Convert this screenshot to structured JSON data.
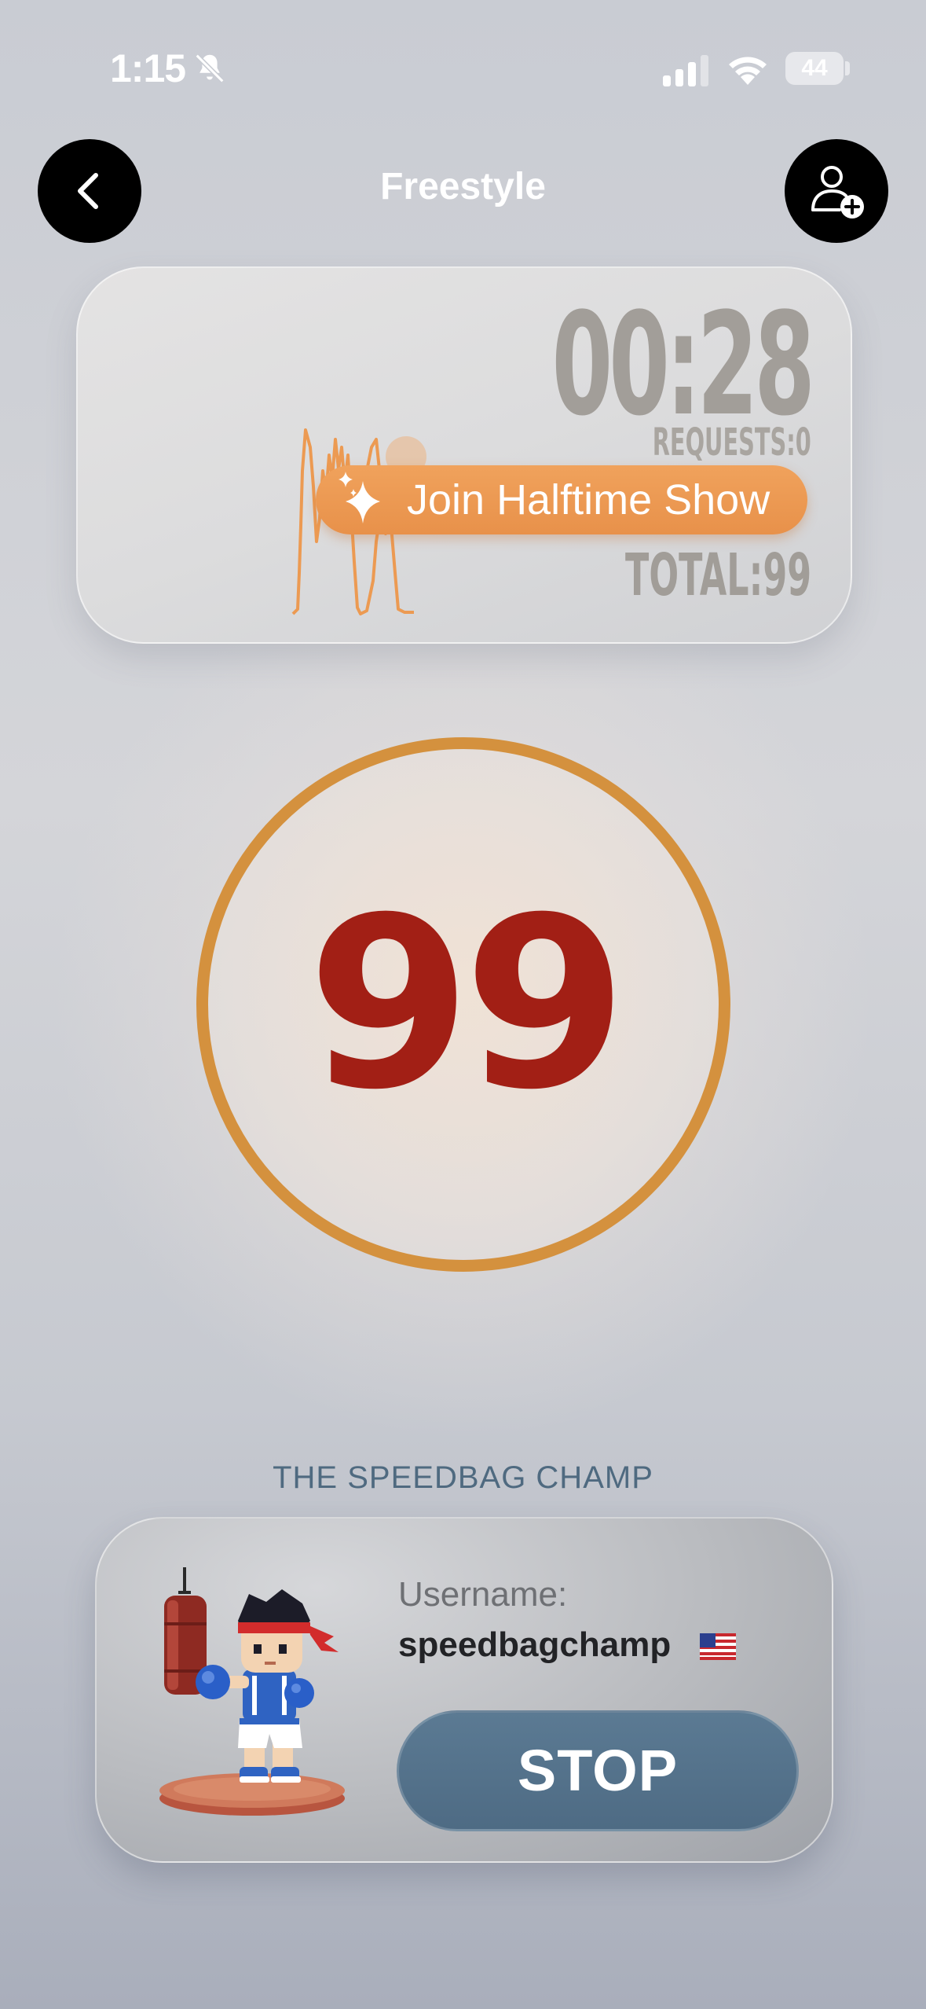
{
  "status_bar": {
    "time": "1:15",
    "battery": "44",
    "icons": [
      "bell-slash-icon",
      "cellular-signal-icon",
      "wifi-icon",
      "battery-icon"
    ]
  },
  "nav": {
    "title": "Freestyle",
    "back_icon": "chevron-left-icon",
    "add_player_icon": "person-add-icon"
  },
  "stats": {
    "timer": "00:28",
    "requests": "REQUESTS:0",
    "total": "TOTAL:99",
    "halftime_label": "Join Halftime Show",
    "halftime_icon": "sparkles-icon"
  },
  "counter": {
    "value": "99"
  },
  "player": {
    "section_title": "THE SPEEDBAG CHAMP",
    "username_label": "Username:",
    "username": "speedbagchamp",
    "flag_icon": "us-flag-icon",
    "stop_label": "STOP"
  },
  "colors": {
    "accent_orange": "#d4913e",
    "halftime_orange": "#ec9a52",
    "counter_red": "#a21f15",
    "stop_blue": "#52708a",
    "section_title": "#4f6a80"
  }
}
